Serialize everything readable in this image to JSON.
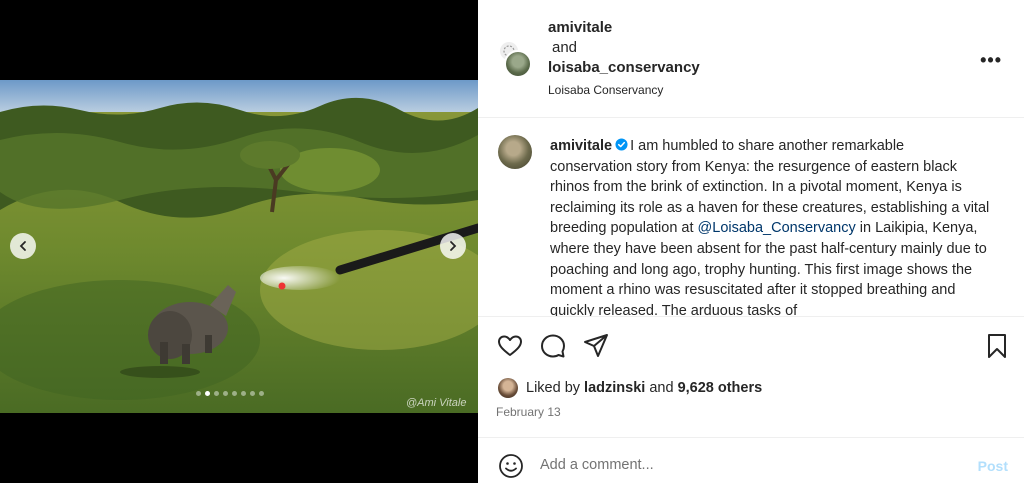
{
  "media": {
    "watermark": "@Ami Vitale",
    "carousel_total": 8,
    "carousel_active_index": 1,
    "icons": {
      "prev": "chevron-left-icon",
      "next": "chevron-right-icon"
    }
  },
  "header": {
    "user1": "amivitale",
    "conjunction": "and",
    "user2": "loisaba_conservancy",
    "location": "Loisaba Conservancy",
    "more_label": "•••"
  },
  "caption": {
    "username": "amivitale",
    "text_before_mention": "I am humbled to share another remarkable conservation story from Kenya: the resurgence of eastern black rhinos from the brink of extinction. In a pivotal moment, Kenya is reclaiming its role as a haven for these creatures, establishing a vital breeding population at ",
    "mention": "@Loisaba_Conservancy",
    "text_after_mention": " in Laikipia, Kenya, where they have been absent for the past half-century mainly due to poaching and long ago, trophy hunting. This first image shows the moment a rhino was resuscitated after it stopped breathing and quickly released. The arduous tasks of",
    "verified_color": "#0095f6"
  },
  "actions": {
    "icons": [
      "heart-icon",
      "comment-icon",
      "share-icon",
      "bookmark-icon"
    ]
  },
  "likes": {
    "prefix": "Liked by",
    "user": "ladzinski",
    "conjunction": "and",
    "others": "9,628 others"
  },
  "date": "February 13",
  "comment": {
    "placeholder": "Add a comment...",
    "post_label": "Post",
    "post_color": "#b2dffc"
  }
}
